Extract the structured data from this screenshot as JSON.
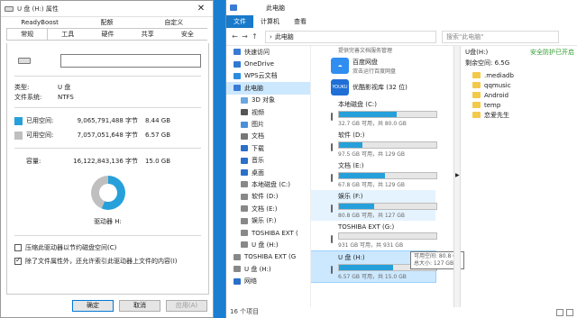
{
  "dialog": {
    "title": "U 盘 (H:) 属性",
    "close_glyph": "✕",
    "tabs_row1": [
      "ReadyBoost",
      "配额",
      "自定义"
    ],
    "tabs_row2": [
      "常规",
      "工具",
      "硬件",
      "共享",
      "安全"
    ],
    "active_tab": "常规",
    "name_value": "",
    "type_label": "类型:",
    "type_value": "U 盘",
    "fs_label": "文件系统:",
    "fs_value": "NTFS",
    "used": {
      "label": "已用空间:",
      "bytes": "9,065,791,488 字节",
      "gb": "8.44 GB",
      "color": "#26a0da"
    },
    "free": {
      "label": "可用空间:",
      "bytes": "7,057,051,648 字节",
      "gb": "6.57 GB",
      "color": "#bfbfbf"
    },
    "capacity": {
      "label": "容量:",
      "bytes": "16,122,843,136 字节",
      "gb": "15.0 GB"
    },
    "used_fraction": 0.562,
    "drive_label": "驱动器 H:",
    "compress_label": "压缩此驱动器以节约磁盘空间(C)",
    "index_label": "除了文件属性外，还允许索引此驱动器上文件的内容(I)",
    "ok": "确定",
    "cancel": "取消",
    "apply": "应用(A)"
  },
  "explorer": {
    "title": "此电脑",
    "ribbon": [
      "文件",
      "计算机",
      "查看"
    ],
    "breadcrumb": "此电脑",
    "search_placeholder": "搜索\"此电脑\"",
    "nav": [
      {
        "label": "快速访问",
        "l2": false,
        "color": "#3a7bd5",
        "sel": false
      },
      {
        "label": "OneDrive",
        "l2": false,
        "color": "#2e7ad1",
        "sel": false
      },
      {
        "label": "WPS云文档",
        "l2": false,
        "color": "#2a8ce0",
        "sel": false
      },
      {
        "label": "此电脑",
        "l2": false,
        "color": "#3a7bd5",
        "sel": true
      },
      {
        "label": "3D 对象",
        "l2": true,
        "color": "#6aa7e0",
        "sel": false
      },
      {
        "label": "视频",
        "l2": true,
        "color": "#555",
        "sel": false
      },
      {
        "label": "图片",
        "l2": true,
        "color": "#4a90d9",
        "sel": false
      },
      {
        "label": "文档",
        "l2": true,
        "color": "#777",
        "sel": false
      },
      {
        "label": "下载",
        "l2": true,
        "color": "#2a6fc9",
        "sel": false
      },
      {
        "label": "音乐",
        "l2": true,
        "color": "#2a6fc9",
        "sel": false
      },
      {
        "label": "桌面",
        "l2": true,
        "color": "#2a6fc9",
        "sel": false
      },
      {
        "label": "本地磁盘 (C:)",
        "l2": true,
        "color": "#888",
        "sel": false
      },
      {
        "label": "软件 (D:)",
        "l2": true,
        "color": "#888",
        "sel": false
      },
      {
        "label": "文档 (E:)",
        "l2": true,
        "color": "#888",
        "sel": false
      },
      {
        "label": "娱乐 (F:)",
        "l2": true,
        "color": "#888",
        "sel": false
      },
      {
        "label": "TOSHIBA EXT (",
        "l2": true,
        "color": "#888",
        "sel": false
      },
      {
        "label": "U 盘 (H:)",
        "l2": true,
        "color": "#888",
        "sel": false
      },
      {
        "label": "TOSHIBA EXT (G",
        "l2": false,
        "color": "#888",
        "sel": false
      },
      {
        "label": "U 盘 (H:)",
        "l2": false,
        "color": "#888",
        "sel": false
      },
      {
        "label": "网络",
        "l2": false,
        "color": "#2a6fc9",
        "sel": false
      }
    ],
    "cut_text": "提供完善文档服务管理",
    "folders": [
      {
        "name": "百度网盘",
        "sub": "双击运行百度网盘",
        "color": "#2f8ef0",
        "glyph": "☁"
      },
      {
        "name": "优酷影视库 (32 位)",
        "sub": "",
        "color": "#1f6fd6",
        "glyph": "YOUKU"
      }
    ],
    "drives": [
      {
        "name": "本地磁盘 (C:)",
        "free": "32.7 GB 可用，共 80.0 GB",
        "used": 0.59,
        "state": ""
      },
      {
        "name": "软件 (D:)",
        "free": "97.5 GB 可用，共 129 GB",
        "used": 0.24,
        "state": ""
      },
      {
        "name": "文档 (E:)",
        "free": "67.8 GB 可用，共 129 GB",
        "used": 0.47,
        "state": ""
      },
      {
        "name": "娱乐 (F:)",
        "free": "80.8 GB 可用，共 127 GB",
        "used": 0.36,
        "state": "hl"
      },
      {
        "name": "TOSHIBA EXT (G:)",
        "free": "931 GB 可用，共 931 GB",
        "used": 0.0,
        "state": ""
      },
      {
        "name": "U 盘 (H:)",
        "free": "6.57 GB 可用，共 15.0 GB",
        "used": 0.56,
        "state": "sel"
      }
    ],
    "tooltip": [
      "可用空间: 80.8 GB",
      "总大小: 127 GB"
    ],
    "right_title": "U盘(H:)",
    "right_safe": "安全防护已开启",
    "right_free": "剩余空间: 6.5G",
    "right_folders": [
      ".mediadb",
      "qqmusic",
      "Android",
      "temp",
      "恋爱先生"
    ],
    "status": "16 个项目"
  }
}
